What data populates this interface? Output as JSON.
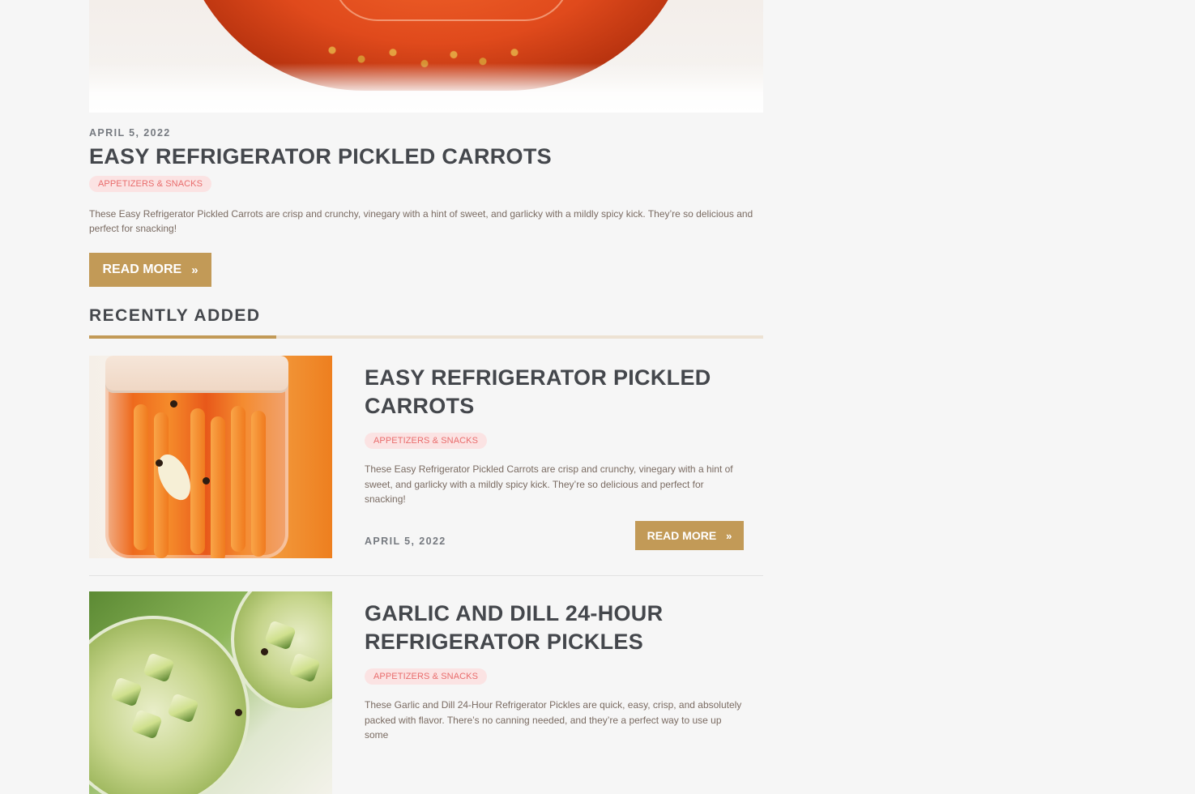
{
  "featured": {
    "image_alt": "Jar of pickled carrots",
    "date": "APRIL 5, 2022",
    "title": "EASY REFRIGERATOR PICKLED CARROTS",
    "category": "APPETIZERS & SNACKS",
    "excerpt": "These Easy Refrigerator Pickled Carrots are crisp and crunchy, vinegary with a hint of sweet, and garlicky with a mildly spicy kick. They’re so delicious and perfect for snacking!",
    "read_more_label": "READ MORE",
    "read_more_icon": "»"
  },
  "recently_added": {
    "heading": "RECENTLY ADDED",
    "posts": [
      {
        "title": "EASY REFRIGERATOR PICKLED CARROTS",
        "category": "APPETIZERS & SNACKS",
        "excerpt": "These Easy Refrigerator Pickled Carrots are crisp and crunchy, vinegary with a hint of sweet, and garlicky with a mildly spicy kick. They’re so delicious and perfect for snacking!",
        "date": "APRIL 5, 2022",
        "read_more_label": "READ MORE",
        "read_more_icon": "»"
      },
      {
        "title": "GARLIC AND DILL 24-HOUR REFRIGERATOR PICKLES",
        "category": "APPETIZERS & SNACKS",
        "excerpt": "These Garlic and Dill 24-Hour Refrigerator Pickles are quick, easy, crisp, and absolutely packed with flavor. There’s no canning needed, and they’re a perfect way to use up some"
      }
    ]
  },
  "colors": {
    "background": "#f6f6f6",
    "accent": "#c29a57",
    "badge_bg": "#fbe3e3",
    "badge_text": "#e96d6d",
    "heading_text": "#44474c",
    "body_text": "#7a6b62"
  }
}
